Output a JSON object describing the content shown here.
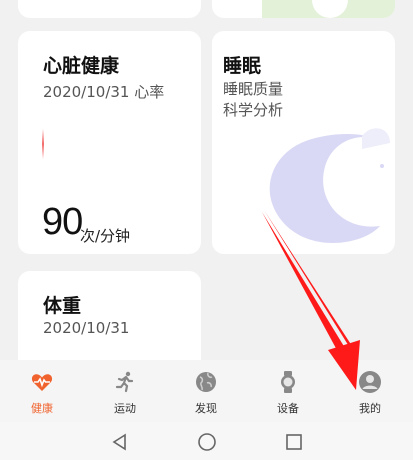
{
  "heart_card": {
    "title": "心脏健康",
    "subtitle": "2020/10/31 心率",
    "value": "90",
    "unit": "次/分钟"
  },
  "sleep_card": {
    "title": "睡眠",
    "line1": "睡眠质量",
    "line2": "科学分析"
  },
  "weight_card": {
    "title": "体重",
    "date": "2020/10/31"
  },
  "tabs": [
    {
      "label": "健康",
      "icon": "heartbeat-icon",
      "active": true
    },
    {
      "label": "运动",
      "icon": "running-icon",
      "active": false
    },
    {
      "label": "发现",
      "icon": "globe-icon",
      "active": false
    },
    {
      "label": "设备",
      "icon": "watch-icon",
      "active": false
    },
    {
      "label": "我的",
      "icon": "profile-icon",
      "active": false
    }
  ],
  "nav": {
    "back": "back-icon",
    "home": "home-icon",
    "recents": "recents-icon"
  },
  "colors": {
    "accent": "#f0632e",
    "arrow": "#ff1a1a",
    "moon": "#d9d9f5"
  }
}
